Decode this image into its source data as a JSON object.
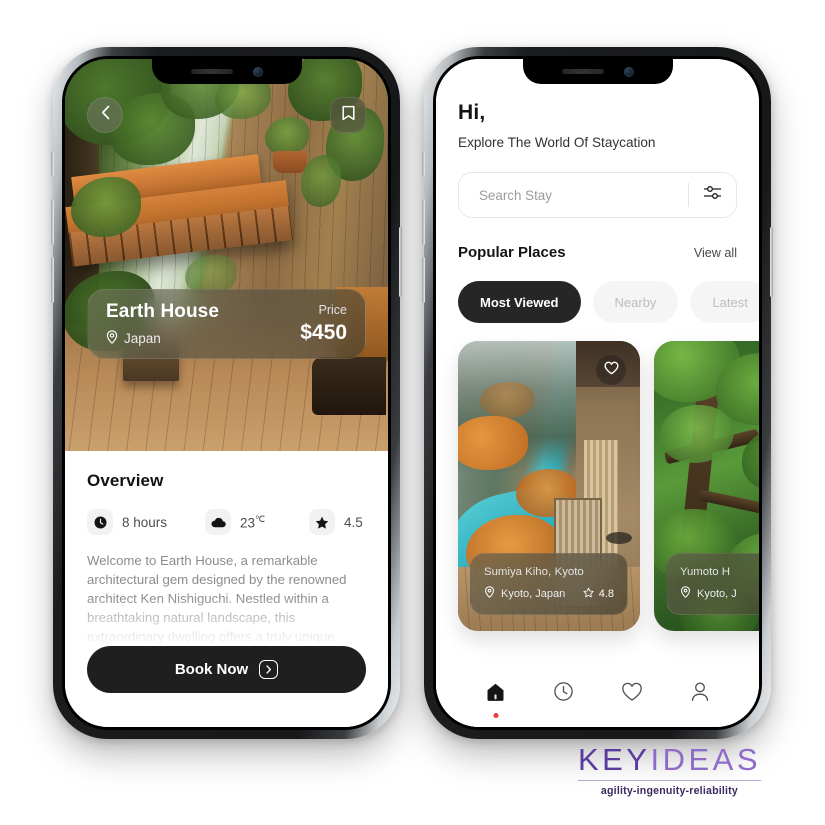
{
  "left_phone": {
    "hero": {
      "back_icon": "chevron-left-icon",
      "bookmark_icon": "bookmark-icon",
      "title": "Earth House",
      "location": "Japan",
      "price_label": "Price",
      "price": "$450",
      "pin_icon": "location-pin-icon"
    },
    "overview": {
      "heading": "Overview",
      "stats": [
        {
          "icon": "clock-icon",
          "value": "8 hours"
        },
        {
          "icon": "cloud-icon",
          "value": "23",
          "unit": "℃"
        },
        {
          "icon": "star-icon",
          "value": "4.5"
        }
      ],
      "description": "Welcome to Earth House, a remarkable architectural gem designed by the renowned architect Ken Nishiguchi. Nestled within a breathtaking natural landscape, this extraordinary dwelling offers a truly unique"
    },
    "cta": {
      "label": "Book Now",
      "arrow_icon": "chevron-right-box-icon"
    }
  },
  "right_phone": {
    "header": {
      "greeting": "Hi,",
      "subtitle": "Explore The World Of Staycation"
    },
    "search": {
      "placeholder": "Search Stay",
      "filter_icon": "sliders-icon"
    },
    "section": {
      "title": "Popular Places",
      "view_all": "View all"
    },
    "tabs": [
      {
        "label": "Most Viewed",
        "active": true
      },
      {
        "label": "Nearby",
        "active": false
      },
      {
        "label": "Latest",
        "active": false
      }
    ],
    "cards": [
      {
        "name": "Sumiya Kiho,",
        "city": "Kyoto",
        "location": "Kyoto, Japan",
        "rating": "4.8",
        "fav_icon": "heart-icon",
        "pin_icon": "location-pin-icon",
        "star_icon": "star-outline-icon"
      },
      {
        "name": "Yumoto H",
        "city": "",
        "location": "Kyoto, J",
        "rating": "",
        "pin_icon": "location-pin-icon"
      }
    ],
    "nav": [
      {
        "icon": "home-icon",
        "active": true
      },
      {
        "icon": "clock-icon",
        "active": false
      },
      {
        "icon": "heart-icon",
        "active": false
      },
      {
        "icon": "user-icon",
        "active": false
      }
    ]
  },
  "logo": {
    "part1": "KEY",
    "part2": "IDEAS",
    "tagline": "agility-ingenuity-reliability",
    "color_dark": "#5a3a9e",
    "color_light": "#8e6bc9"
  }
}
